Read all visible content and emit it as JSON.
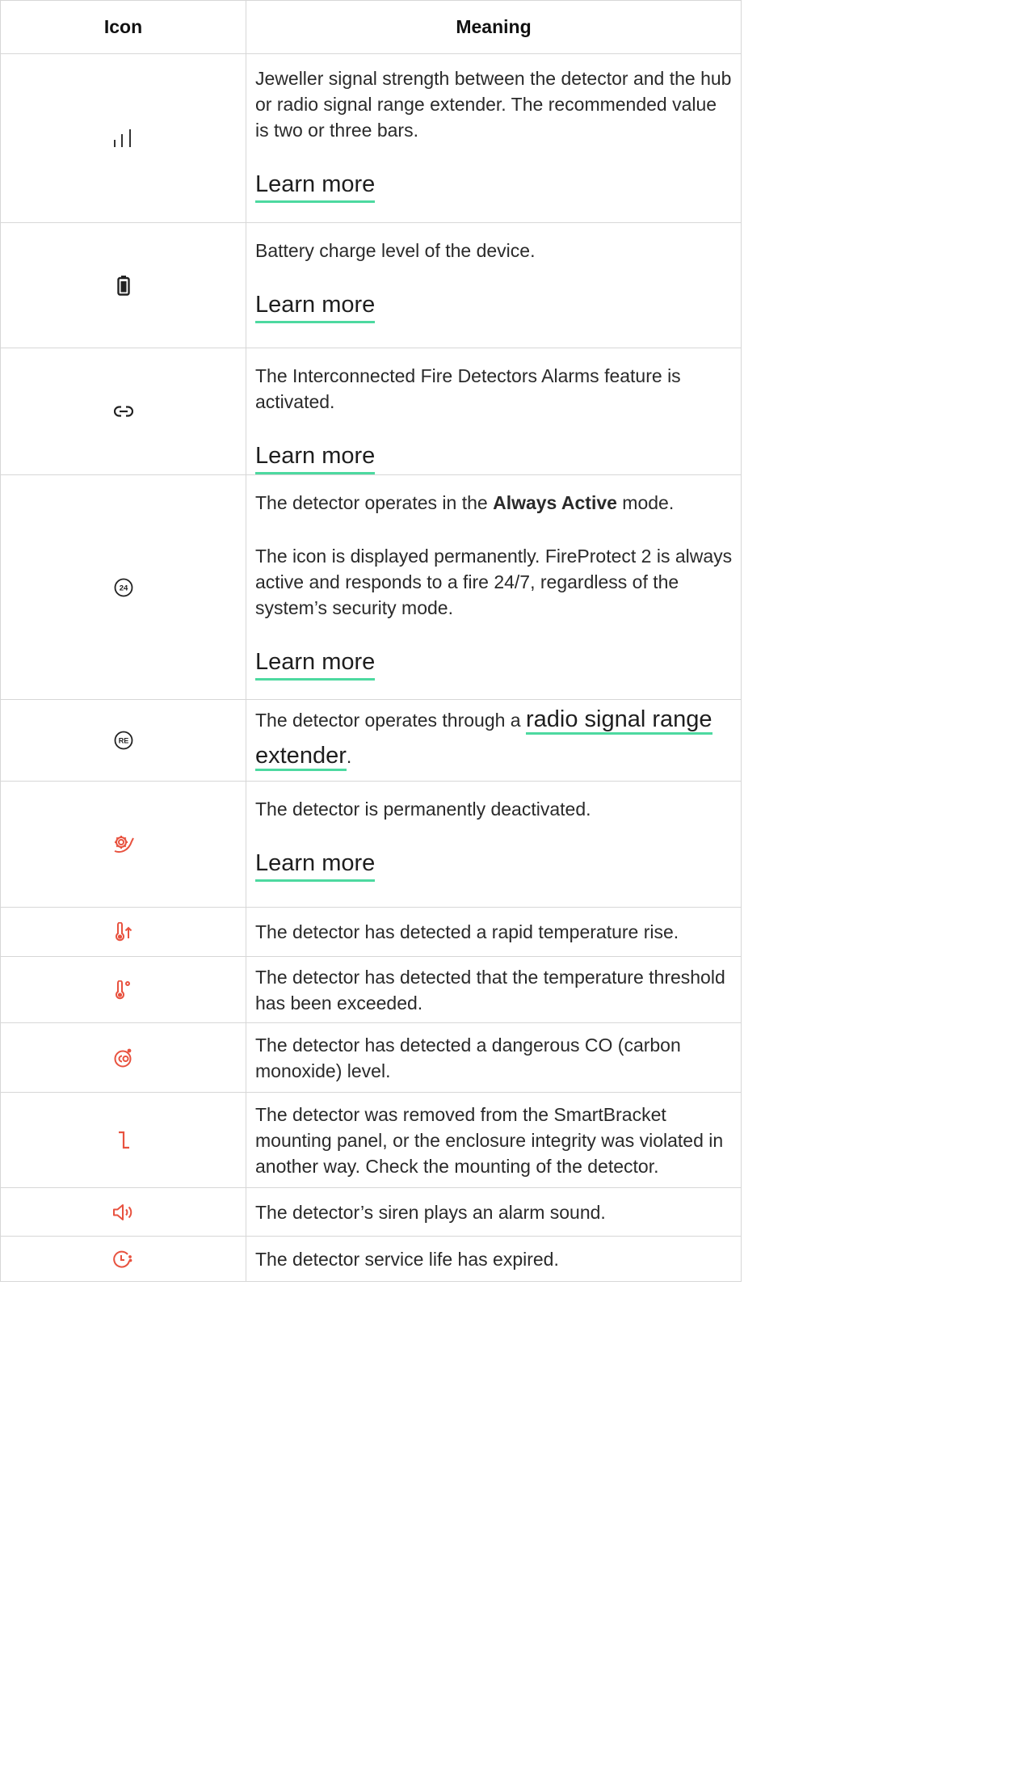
{
  "header": {
    "icon": "Icon",
    "meaning": "Meaning"
  },
  "link_color": "#4dd9a0",
  "alert_color": "#e8523f",
  "rows": [
    {
      "icon": "signal-strength-icon",
      "text": "Jeweller signal strength between the detector and the hub or radio signal range extender. The recommended value is two or three bars.",
      "link": "Learn more"
    },
    {
      "icon": "battery-icon",
      "text": "Battery charge level of the device.",
      "link": "Learn more"
    },
    {
      "icon": "link-icon",
      "text": "The Interconnected Fire Detectors Alarms feature is activated.",
      "link": "Learn more"
    },
    {
      "icon": "always-active-24-icon",
      "text_pre": "The detector operates in the ",
      "text_bold": "Always Active",
      "text_post": " mode.",
      "text2": "The icon is displayed permanently. FireProtect 2 is always active and responds to a fire 24/7, regardless of the system’s security mode.",
      "link": "Learn more"
    },
    {
      "icon": "range-extender-re-icon",
      "text_pre": "The detector operates through a ",
      "link": "radio signal range extender",
      "text_post": "."
    },
    {
      "icon": "deactivated-gear-icon",
      "text": "The detector is permanently deactivated.",
      "link": "Learn more"
    },
    {
      "icon": "temperature-rise-icon",
      "text": "The detector has detected a rapid temperature rise."
    },
    {
      "icon": "temperature-threshold-icon",
      "text": "The detector has detected that the temperature threshold has been exceeded."
    },
    {
      "icon": "co-icon",
      "text": "The detector has detected a dangerous CO (carbon monoxide) level."
    },
    {
      "icon": "tamper-icon",
      "text": "The detector was removed from the SmartBracket mounting panel, or the enclosure integrity was violated in another way. Check the mounting of the detector."
    },
    {
      "icon": "siren-speaker-icon",
      "text": "The detector’s siren plays an alarm sound."
    },
    {
      "icon": "service-life-clock-icon",
      "text": "The detector service life has expired."
    }
  ]
}
